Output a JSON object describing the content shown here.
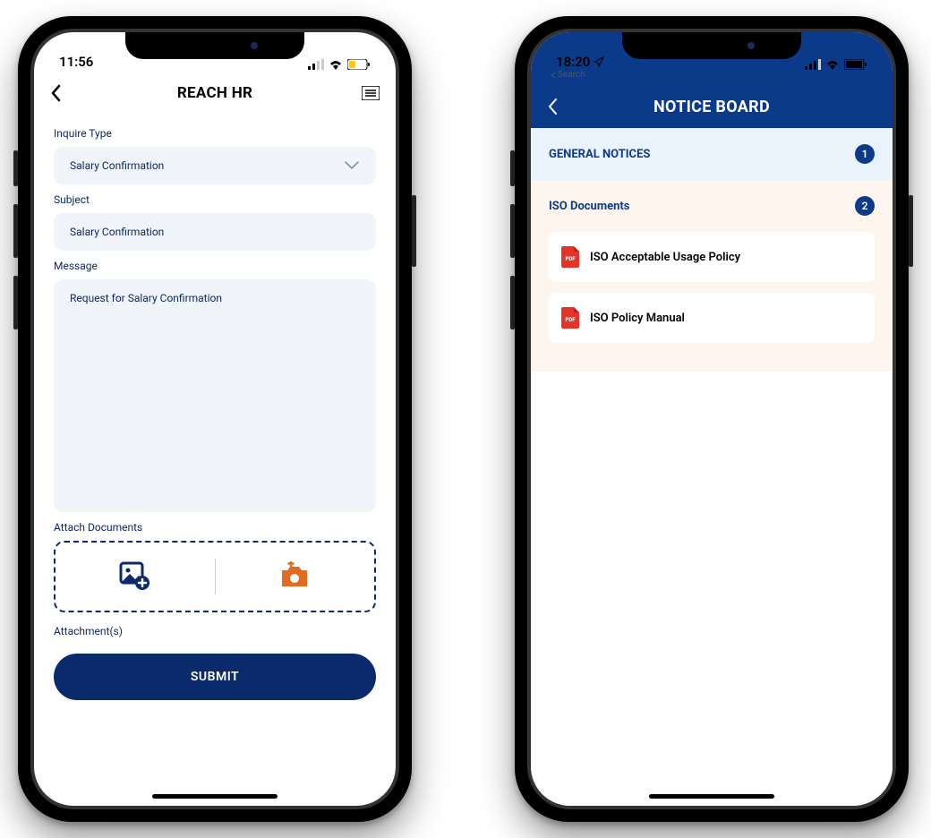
{
  "left": {
    "status": {
      "time": "11:56"
    },
    "header": {
      "title": "REACH HR"
    },
    "form": {
      "inquire_label": "Inquire Type",
      "inquire_value": "Salary Confirmation",
      "subject_label": "Subject",
      "subject_value": "Salary Confirmation",
      "message_label": "Message",
      "message_value": "Request for Salary Confirmation",
      "attach_label": "Attach Documents",
      "attachments_label": "Attachment(s)",
      "submit_label": "SUBMIT"
    }
  },
  "right": {
    "status": {
      "time": "18:20",
      "back_app": "Search"
    },
    "header": {
      "title": "NOTICE BOARD"
    },
    "sections": {
      "general": {
        "title": "GENERAL NOTICES",
        "count": "1"
      },
      "iso": {
        "title": "ISO Documents",
        "count": "2",
        "docs": [
          {
            "name": "ISO Acceptable Usage Policy"
          },
          {
            "name": "ISO Policy Manual"
          }
        ]
      }
    }
  }
}
